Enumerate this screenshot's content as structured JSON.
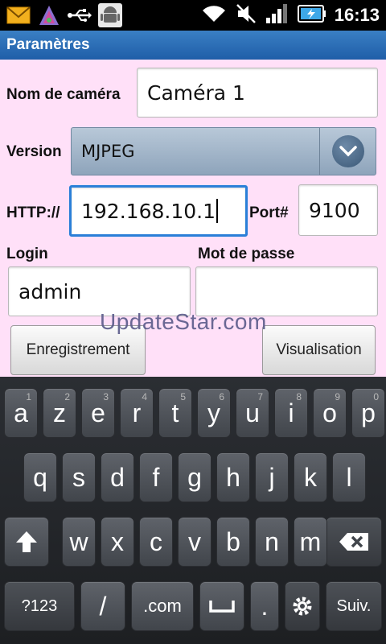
{
  "status": {
    "time": "16:13",
    "icons": [
      "mail-icon",
      "app-launcher-icon",
      "usb-icon",
      "android-debug-icon",
      "wifi-icon",
      "mute-icon",
      "signal-icon",
      "battery-icon"
    ]
  },
  "title": "Paramètres",
  "form": {
    "camera_name_label": "Nom de caméra",
    "camera_name_value": "Caméra 1",
    "version_label": "Version",
    "version_value": "MJPEG",
    "http_label": "HTTP://",
    "http_value": "192.168.10.1",
    "port_label": "Port#",
    "port_value": "9100",
    "login_label": "Login",
    "login_value": "admin",
    "password_label": "Mot de passe",
    "password_value": "",
    "save_button": "Enregistrement",
    "view_button": "Visualisation"
  },
  "watermark": "UpdateStar.com",
  "keyboard": {
    "row1": [
      {
        "k": "a",
        "h": "1"
      },
      {
        "k": "z",
        "h": "2"
      },
      {
        "k": "e",
        "h": "3"
      },
      {
        "k": "r",
        "h": "4"
      },
      {
        "k": "t",
        "h": "5"
      },
      {
        "k": "y",
        "h": "6"
      },
      {
        "k": "u",
        "h": "7"
      },
      {
        "k": "i",
        "h": "8"
      },
      {
        "k": "o",
        "h": "9"
      },
      {
        "k": "p",
        "h": "0"
      }
    ],
    "row2": [
      "q",
      "s",
      "d",
      "f",
      "g",
      "h",
      "j",
      "k",
      "l"
    ],
    "row3": [
      "w",
      "x",
      "c",
      "v",
      "b",
      "n",
      "m"
    ],
    "symbols_key": "?123",
    "slash_key": "/",
    "dotcom_key": ".com",
    "dot_key": ".",
    "next_key": "Suiv."
  },
  "colors": {
    "form_bg": "#ffe0f8",
    "titlebar": "#2a6db5",
    "focus": "#2a7fd8"
  }
}
